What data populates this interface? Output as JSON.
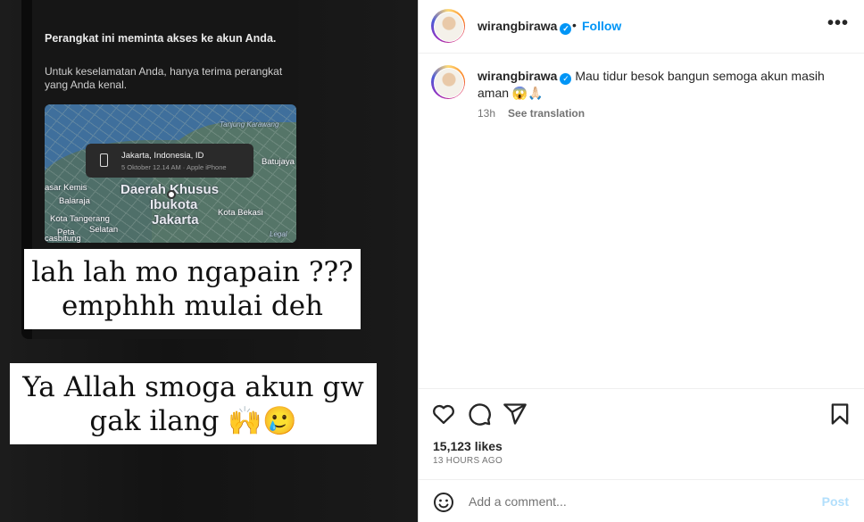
{
  "post_image": {
    "alert_title": "Perangkat ini meminta akses ke akun Anda.",
    "alert_body": "Untuk keselamatan Anda, hanya terima perangkat yang Anda kenal.",
    "map": {
      "callout_location": "Jakarta, Indonesia, ID",
      "callout_detail": "5 Oktober 12.14 AM · Apple iPhone",
      "labels": {
        "tanjung_karawang": "Tanjung Karawang",
        "batujaya": "Batujaya",
        "pasar_kemis": "asar Kemis",
        "balaraja": "Balaraja",
        "dki_line1": "Daerah Khusus",
        "dki_line2": "Ibukota",
        "dki_line3": "Jakarta",
        "kota_bekasi": "Kota Bekasi",
        "kota_tangerang": "Kota Tangerang",
        "selatan": "Selatan",
        "peta": "Peta",
        "casbitung": "casbitung",
        "legal": "Legal"
      }
    },
    "caption1_line1": "lah lah mo ngapain ???",
    "caption1_line2": "emphhh mulai deh",
    "caption2_line1": "Ya Allah smoga akun gw",
    "caption2_line2": "gak ilang 🙌🥲"
  },
  "header": {
    "username": "wirangbirawa",
    "separator": "•",
    "follow_label": "Follow",
    "more_label": "•••"
  },
  "caption": {
    "username": "wirangbirawa",
    "text": "Mau tidur besok bangun semoga akun masih aman 😱🙏🏻",
    "age": "13h",
    "translate_label": "See translation"
  },
  "engagement": {
    "likes": "15,123 likes",
    "timestamp": "13 HOURS AGO"
  },
  "comment_box": {
    "placeholder": "Add a comment...",
    "post_label": "Post"
  },
  "colors": {
    "accent": "#0095f6",
    "post_disabled": "#b2dffc",
    "text": "#262626",
    "muted": "#737373"
  }
}
